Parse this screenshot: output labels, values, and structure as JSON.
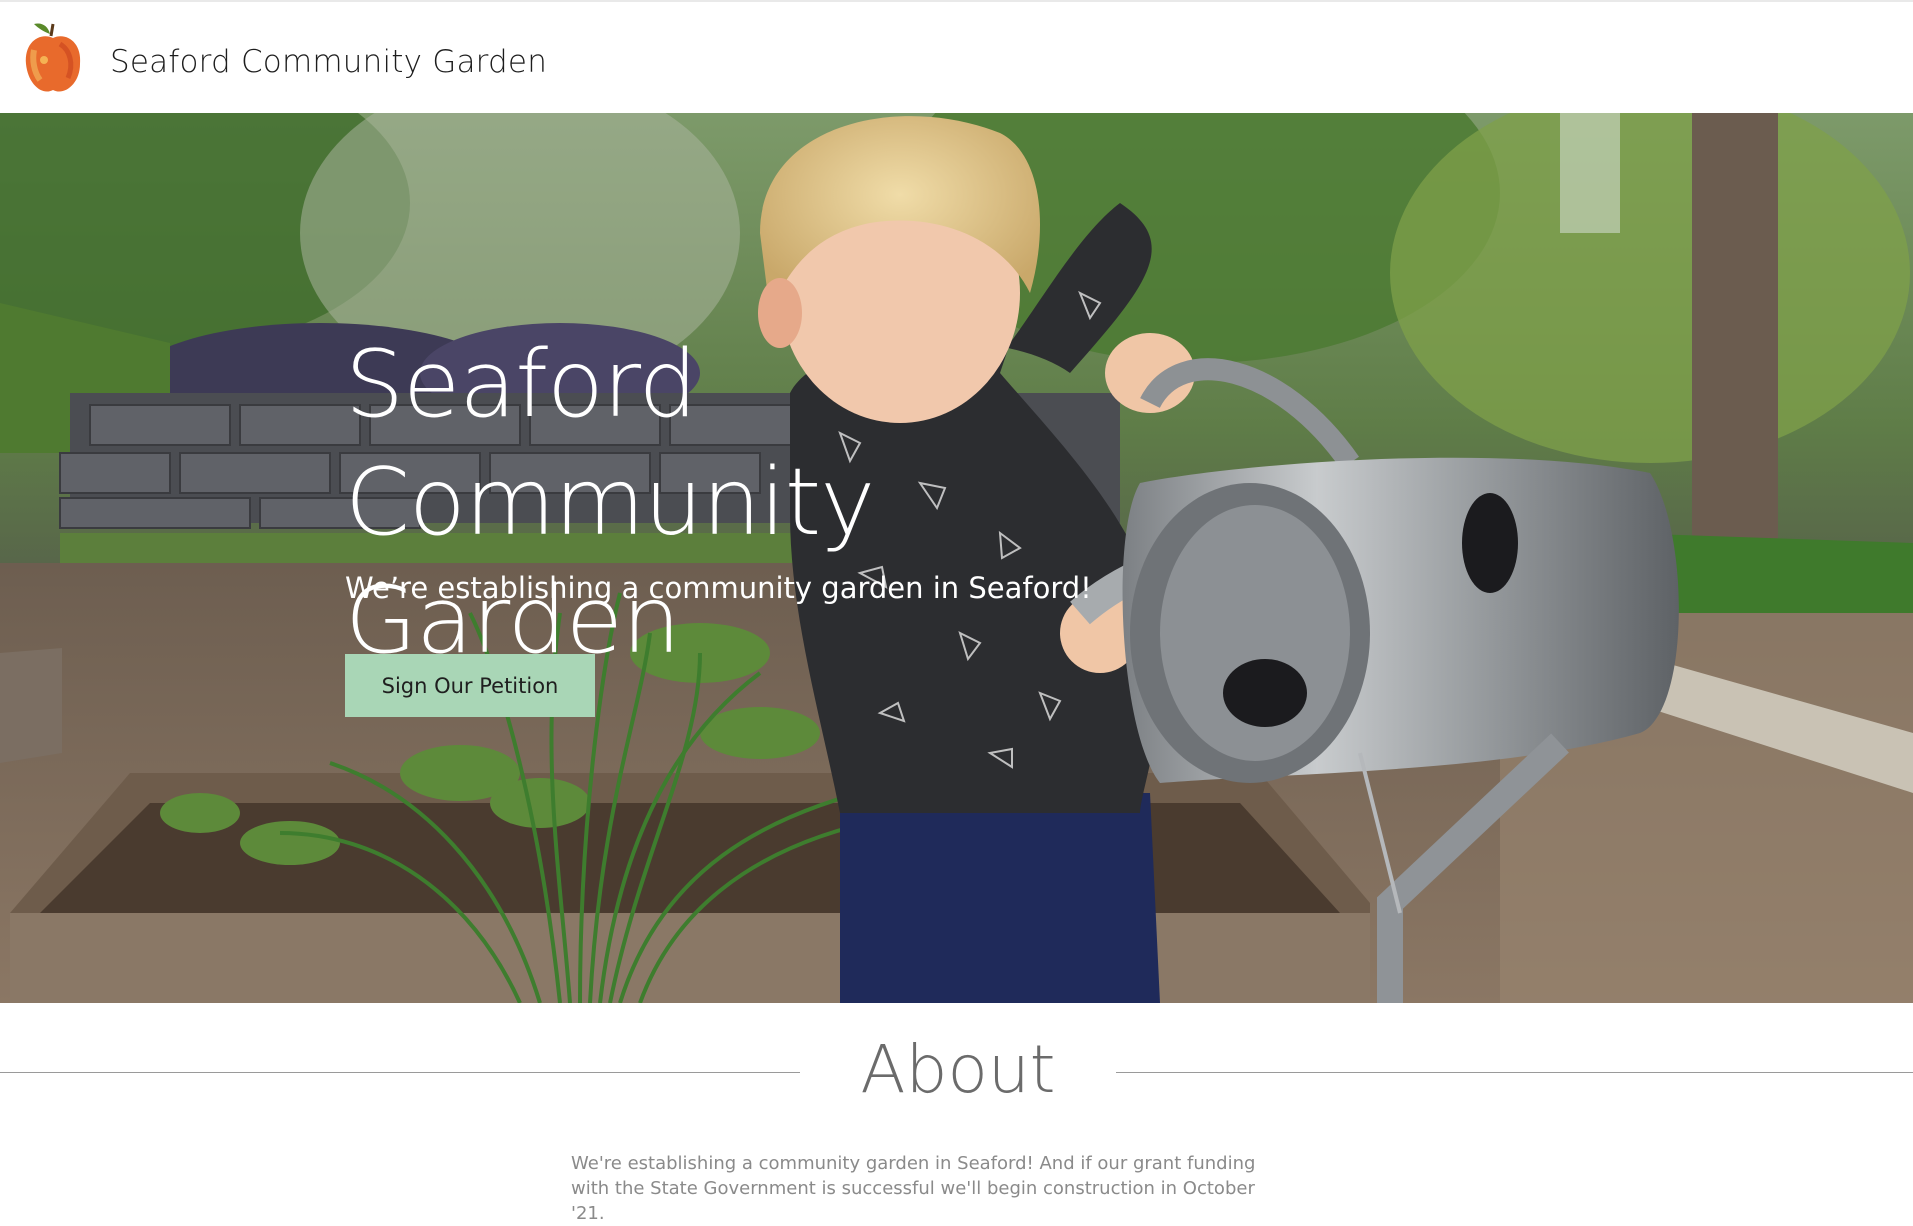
{
  "header": {
    "site_title": "Seaford Community Garden",
    "logo_icon": "apple-icon"
  },
  "hero": {
    "title": "Seaford Community Garden",
    "subtitle": "We’re establishing a community garden in Seaford!",
    "button_label": "Sign Our Petition",
    "button_color": "#a9d6b6"
  },
  "about": {
    "heading": "About",
    "body": "We're establishing a community garden in Seaford! And if our grant funding with the State Government is successful we'll begin construction in October '21."
  }
}
